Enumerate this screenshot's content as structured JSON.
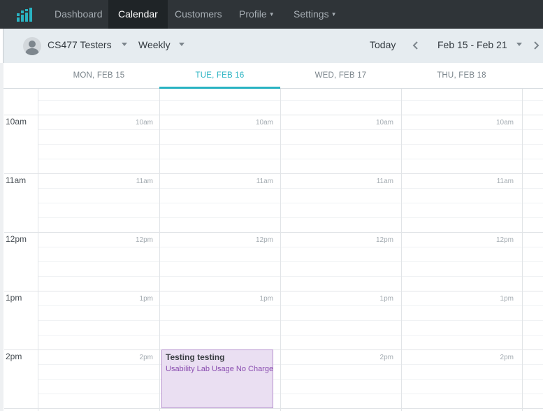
{
  "nav": {
    "items": [
      {
        "label": "Dashboard",
        "active": false,
        "dropdown": false
      },
      {
        "label": "Calendar",
        "active": true,
        "dropdown": false
      },
      {
        "label": "Customers",
        "active": false,
        "dropdown": false
      },
      {
        "label": "Profile",
        "active": false,
        "dropdown": true
      },
      {
        "label": "Settings",
        "active": false,
        "dropdown": true
      }
    ]
  },
  "toolbar": {
    "group_label": "CS477 Testers",
    "view_label": "Weekly",
    "today_label": "Today",
    "range_label": "Feb 15 - Feb 21"
  },
  "days": [
    {
      "label": "MON, FEB 15",
      "active": false
    },
    {
      "label": "TUE, FEB 16",
      "active": true
    },
    {
      "label": "WED, FEB 17",
      "active": false
    },
    {
      "label": "THU, FEB 18",
      "active": false
    }
  ],
  "hours": [
    "10am",
    "11am",
    "12pm",
    "1pm",
    "2pm"
  ],
  "event": {
    "title": "Testing testing",
    "subtitle": "Usability Lab Usage No Charge"
  },
  "colors": {
    "nav_bg": "#2f3438",
    "accent": "#29b3c2",
    "event_bg": "#eadff2",
    "event_border": "#b792cf",
    "event_text": "#8a4db0"
  }
}
